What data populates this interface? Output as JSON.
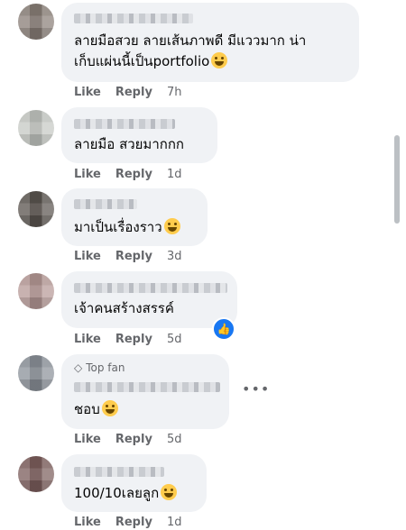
{
  "comments": [
    {
      "text_line1": "ลายมือสวย ลายเส้นภาพดี มีแววมาก น่า",
      "text_line2": "เก็บแผ่นนี้เป็นportfolio",
      "emoji": "grinning-face-icon",
      "like": "Like",
      "reply": "Reply",
      "time": "7h"
    },
    {
      "text": "ลายมือ สวยมากกก",
      "like": "Like",
      "reply": "Reply",
      "time": "1d"
    },
    {
      "text": "มาเป็นเรื่องราว",
      "emoji": "grinning-squinting-face-icon",
      "like": "Like",
      "reply": "Reply",
      "time": "3d"
    },
    {
      "text": "เจ้าคนสร้างสรรค์",
      "reaction": "like-icon",
      "like": "Like",
      "reply": "Reply",
      "time": "5d"
    },
    {
      "badge": "Top fan",
      "text": "ชอบ",
      "emoji": "grinning-squinting-face-icon",
      "like": "Like",
      "reply": "Reply",
      "time": "5d"
    },
    {
      "text": "100/10เลยลูก",
      "emoji": "rolling-on-floor-laughing-icon",
      "like": "Like",
      "reply": "Reply",
      "time": "1d"
    }
  ],
  "colors": {
    "bubble": "#f0f2f5",
    "meta_text": "#65676b",
    "like_blue": "#1877f2"
  }
}
